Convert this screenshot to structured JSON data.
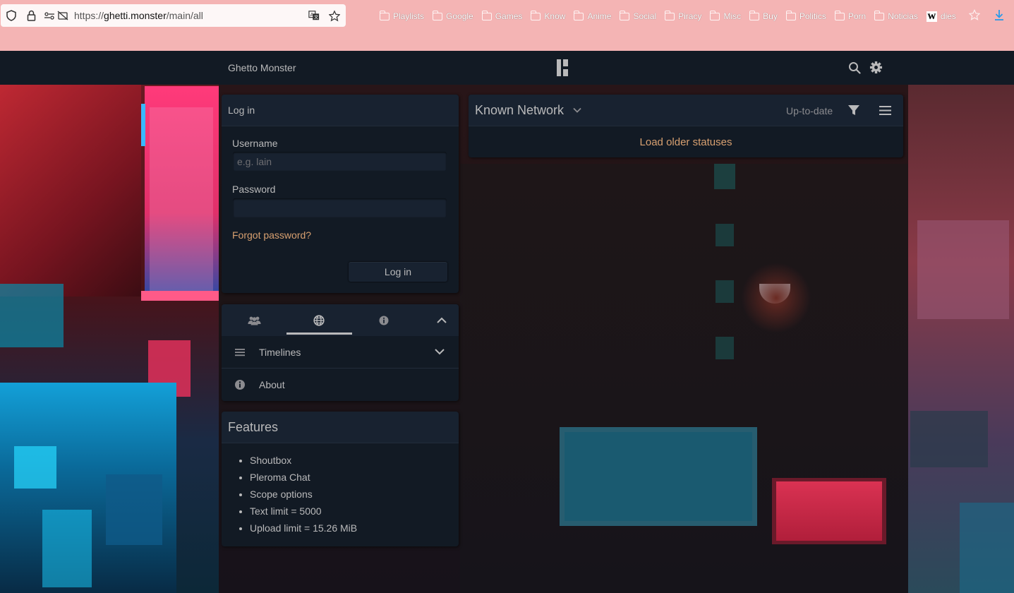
{
  "browser": {
    "url_prefix": "https://",
    "url_domain": "ghetti.monster",
    "url_path": "/main/all",
    "bookmarks": [
      "Playlists",
      "Google",
      "Games",
      "Know",
      "Anime",
      "Social",
      "Piracy",
      "Misc",
      "Buy",
      "Politics",
      "Porn",
      "Noticias"
    ],
    "wiki_bookmark": "dies",
    "wiki_logo": "W"
  },
  "nav": {
    "instance_name": "Ghetto Monster"
  },
  "login": {
    "title": "Log in",
    "username_label": "Username",
    "username_placeholder": "e.g. lain",
    "password_label": "Password",
    "forgot_password": "Forgot password?",
    "submit_label": "Log in"
  },
  "side_nav": {
    "items": [
      {
        "label": "Timelines",
        "icon": "bars-icon"
      },
      {
        "label": "About",
        "icon": "info-icon"
      }
    ],
    "tabs": [
      {
        "icon": "users-icon"
      },
      {
        "icon": "globe-icon"
      },
      {
        "icon": "info-circle-icon"
      }
    ]
  },
  "features": {
    "title": "Features",
    "items": [
      "Shoutbox",
      "Pleroma Chat",
      "Scope options",
      "Text limit = 5000",
      "Upload limit = 15.26 MiB"
    ]
  },
  "timeline": {
    "title": "Known Network",
    "status": "Up-to-date",
    "load_older": "Load older statuses"
  },
  "colors": {
    "chrome_bg": "#f4b4b4",
    "panel_bg": "#121a24",
    "panel_header": "#182230",
    "text": "#b9b9ba",
    "link": "#d8a070"
  }
}
